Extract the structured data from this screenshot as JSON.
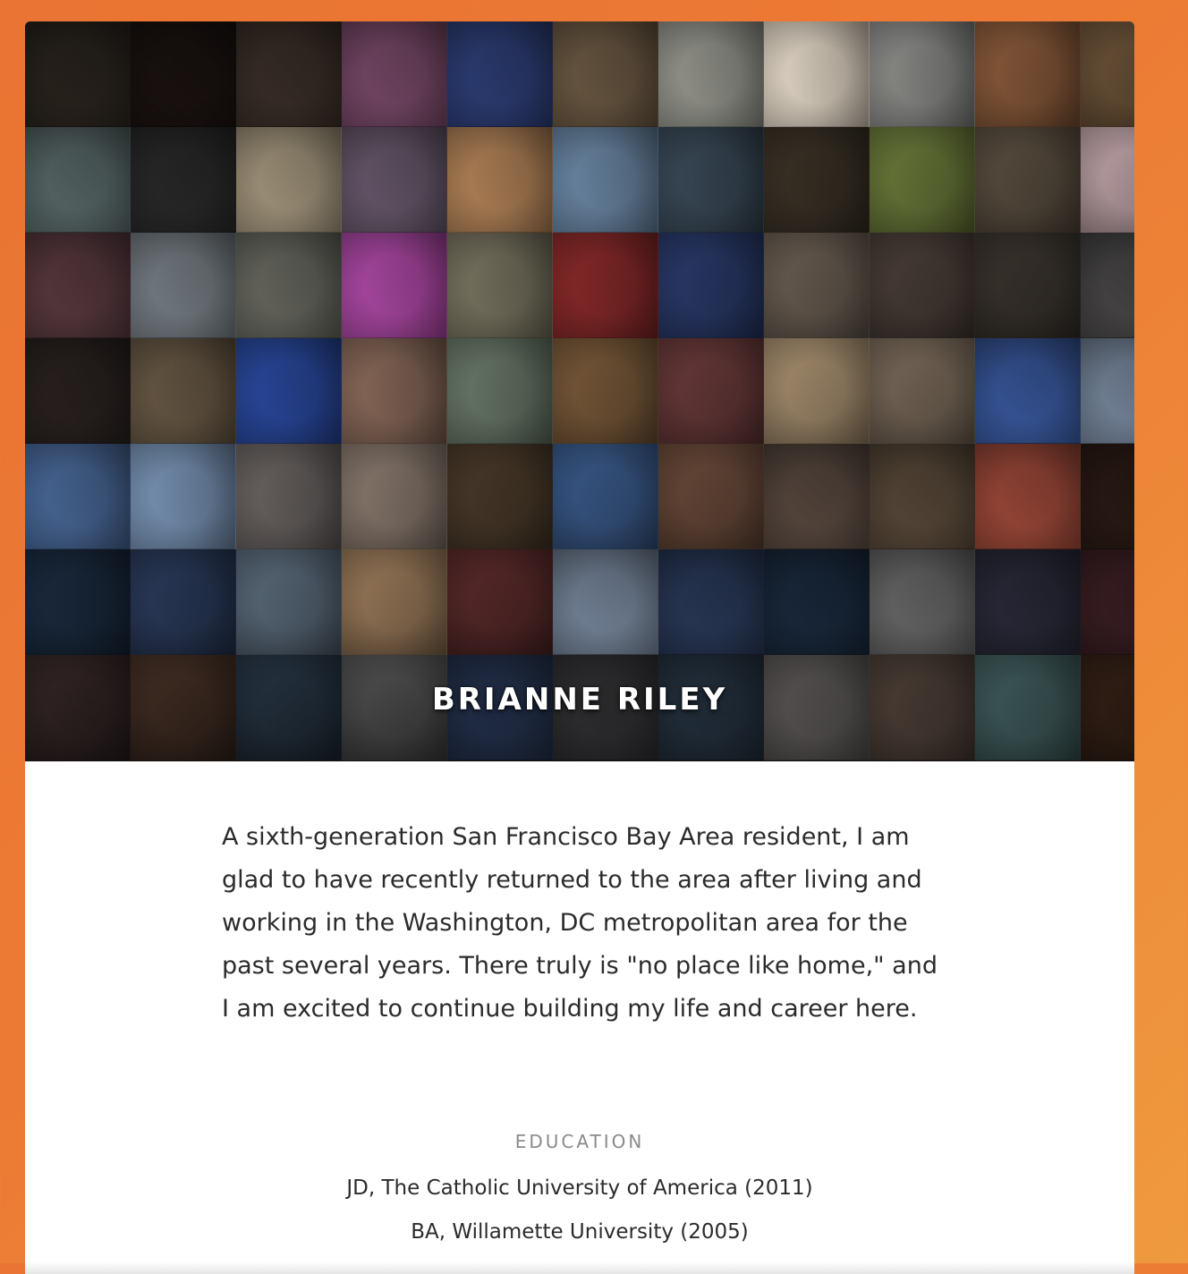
{
  "profile": {
    "name": "BRIANNE RILEY",
    "bio": "A sixth-generation San Francisco Bay Area resident, I am glad to have recently returned to the area after living and working in the Washington, DC metropolitan area for the past several years. There truly is \"no place like home,\" and I am excited to continue building my life and career here."
  },
  "education": {
    "heading": "EDUCATION",
    "items": [
      "JD, The Catholic University of America (2011)",
      "BA, Willamette University (2005)"
    ]
  },
  "theme": {
    "background_orange": "#ec7a34",
    "card_background": "#ffffff",
    "text_color": "#2b2b2b",
    "heading_gray": "#8a8a8a"
  },
  "mosaic_palette": [
    [
      "#2a241e",
      "#1a1210",
      "#3b2f28",
      "#7a4a6a",
      "#2e3f78",
      "#6d5a44",
      "#9a9a92",
      "#e8dccb",
      "#8d8d8a",
      "#8a5a3a",
      "#6b5238"
    ],
    [
      "#5a6a6a",
      "#2a2a2a",
      "#a89a80",
      "#6a5a6e",
      "#b7865a",
      "#6d8aa8",
      "#3a4a58",
      "#3a3226",
      "#6b7a3a",
      "#5a4e40",
      "#c0a4a8"
    ],
    [
      "#5a3a40",
      "#7a8288",
      "#6a6a62",
      "#b04aa8",
      "#7a7662",
      "#8a2a2a",
      "#2a3a6a",
      "#6a5e52",
      "#4a3e38",
      "#3a342e",
      "#4a4848"
    ],
    [
      "#2a2220",
      "#6a5a46",
      "#2a4aa0",
      "#8a6a5a",
      "#6a7a6a",
      "#7a5a3a",
      "#6a3a3a",
      "#a89070",
      "#7a6a5a",
      "#3a5aa0",
      "#7a8aa0"
    ],
    [
      "#4a6a9a",
      "#7a96b8",
      "#6a6462",
      "#8a7a6e",
      "#4a3a2a",
      "#3a5a8a",
      "#6a4a3a",
      "#5a4a40",
      "#5a4a3a",
      "#a04a3a",
      "#2a1a14"
    ],
    [
      "#1a2a3e",
      "#2a3a5a",
      "#5a6a7a",
      "#9a7a5a",
      "#5a2a2a",
      "#7a8aa0",
      "#2a3a5a",
      "#1a2a3e",
      "#6a6a6a",
      "#2a2a3a",
      "#3a1e22"
    ],
    [
      "#3a2a2a",
      "#4a3428",
      "#2a3a4a",
      "#5a5a5a",
      "#2a3a5a",
      "#3a3a3e",
      "#2a3a4a",
      "#6a6664",
      "#5a4a40",
      "#4a6a6a",
      "#3a2418"
    ]
  ]
}
